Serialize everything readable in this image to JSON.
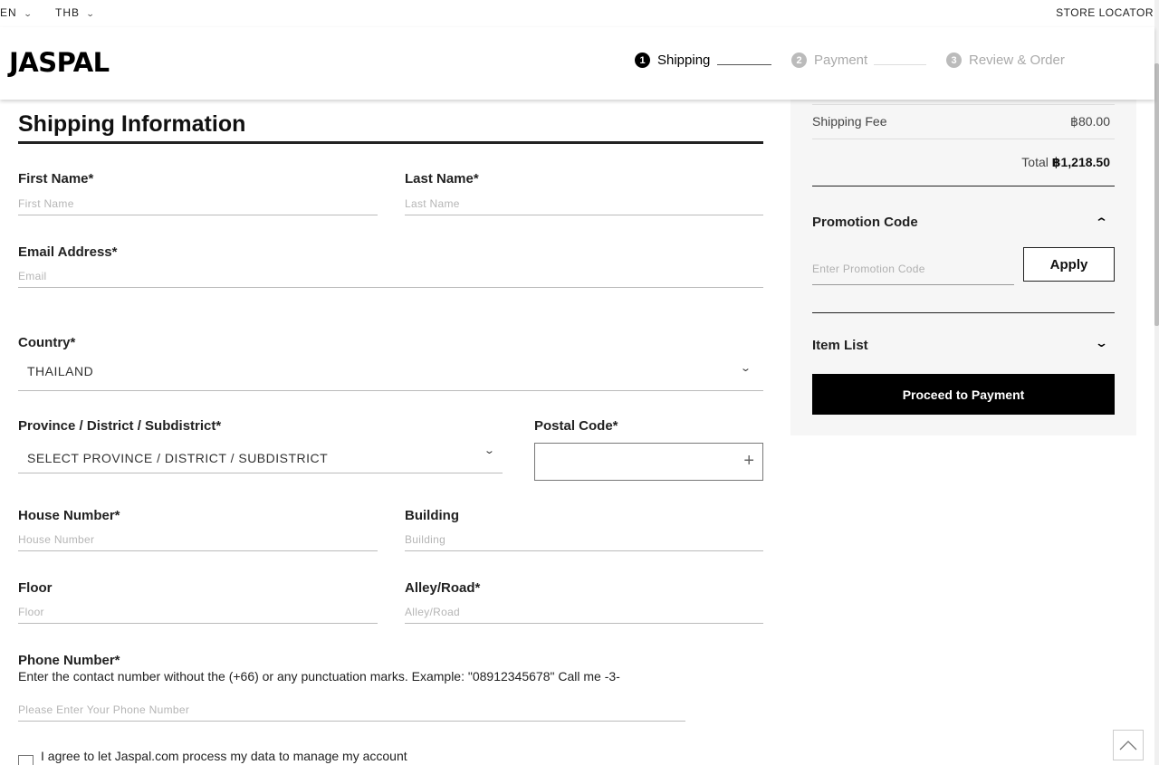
{
  "topbar": {
    "language": "EN",
    "currency": "THB",
    "store_locator": "STORE LOCATOR"
  },
  "header": {
    "logo": "JASPAL",
    "steps": [
      {
        "number": "1",
        "label": "Shipping",
        "state": "active"
      },
      {
        "number": "2",
        "label": "Payment",
        "state": "inactive"
      },
      {
        "number": "3",
        "label": "Review & Order",
        "state": "inactive"
      }
    ]
  },
  "form": {
    "title": "Shipping Information",
    "first_name": {
      "label": "First Name*",
      "placeholder": "First Name",
      "value": ""
    },
    "last_name": {
      "label": "Last Name*",
      "placeholder": "Last Name",
      "value": ""
    },
    "email": {
      "label": "Email Address*",
      "placeholder": "Email",
      "value": ""
    },
    "country": {
      "label": "Country*",
      "value": "THAILAND"
    },
    "province": {
      "label": "Province / District / Subdistrict*",
      "value": "SELECT PROVINCE / DISTRICT / SUBDISTRICT"
    },
    "postal_code": {
      "label": "Postal Code*",
      "value": ""
    },
    "house_number": {
      "label": "House Number*",
      "placeholder": "House Number",
      "value": ""
    },
    "building": {
      "label": "Building",
      "placeholder": "Building",
      "value": ""
    },
    "floor": {
      "label": "Floor",
      "placeholder": "Floor",
      "value": ""
    },
    "alley": {
      "label": "Alley/Road*",
      "placeholder": "Alley/Road",
      "value": ""
    },
    "phone": {
      "label": "Phone Number*",
      "hint": "Enter the contact number without the (+66) or any punctuation marks. Example: \"08912345678\" Call me -3-",
      "placeholder": "Please Enter Your Phone Number",
      "value": ""
    },
    "agree_text": "I agree to let Jaspal.com process my data to manage my account"
  },
  "summary": {
    "shipping_fee_label": "Shipping Fee",
    "shipping_fee_value": "฿80.00",
    "total_label": "Total",
    "total_value": "฿1,218.50",
    "promo": {
      "title": "Promotion Code",
      "placeholder": "Enter Promotion Code",
      "apply_label": "Apply"
    },
    "item_list_title": "Item List",
    "proceed_label": "Proceed to Payment"
  },
  "icons": {
    "chevron_down": "chevron-down-icon",
    "chevron_up": "chevron-up-icon",
    "plus": "plus-icon",
    "back_to_top": "arrow-up-icon"
  }
}
